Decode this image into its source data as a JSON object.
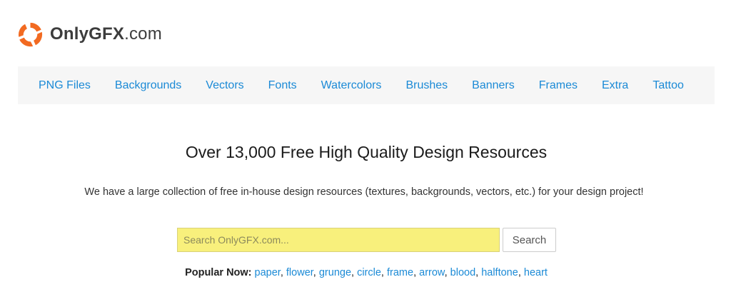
{
  "header": {
    "logo_icon": "onlygfx-ring-logo-icon",
    "logo_bold": "OnlyGFX",
    "logo_rest": ".com",
    "accent_color": "#f26a21"
  },
  "nav": {
    "items": [
      "PNG Files",
      "Backgrounds",
      "Vectors",
      "Fonts",
      "Watercolors",
      "Brushes",
      "Banners",
      "Frames",
      "Extra",
      "Tattoo"
    ],
    "link_color": "#1b8ad6"
  },
  "main": {
    "headline": "Over 13,000 Free High Quality Design Resources",
    "tagline": "We have a large collection of free in-house design resources (textures, backgrounds, vectors, etc.) for your design project!"
  },
  "search": {
    "placeholder": "Search OnlyGFX.com...",
    "value": "",
    "button_label": "Search",
    "input_color": "#f8f07c"
  },
  "popular": {
    "label": "Popular Now:",
    "tags": [
      "paper",
      "flower",
      "grunge",
      "circle",
      "frame",
      "arrow",
      "blood",
      "halftone",
      "heart"
    ]
  }
}
